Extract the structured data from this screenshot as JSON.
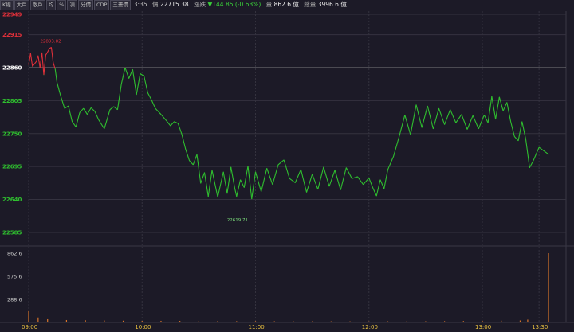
{
  "toolbar": {
    "buttons": [
      "K線",
      "大戶",
      "散戶",
      "均",
      "%",
      "凍",
      "分價",
      "CDP",
      "三畫價"
    ]
  },
  "quote": {
    "time": "13:35",
    "price_label": "價",
    "price": "22715.38",
    "change_label": "漲跌",
    "change": "▼144.85 (-0.63%)",
    "volume_label": "量",
    "volume": "862.6 億",
    "total_label": "總量",
    "total": "3996.6 億"
  },
  "colors": {
    "background": "#1c1a27",
    "up": "#e0303a",
    "down": "#2fbf2f",
    "reference_line": "#9a9a9a",
    "grid": "#34323f",
    "volume_bar": "#d8742a",
    "axis_time": "#e8c040",
    "high_annotation": "#e0303a",
    "low_annotation": "#7ce07c"
  },
  "chart_data": {
    "type": "line",
    "title": "",
    "reference_price": 22860,
    "price_range": [
      22565,
      22949
    ],
    "price_ticks": [
      "22949",
      "22915",
      "22860",
      "22805",
      "22750",
      "22695",
      "22640",
      "22585"
    ],
    "price_tick_values": [
      22949,
      22915,
      22860,
      22805,
      22750,
      22695,
      22640,
      22585
    ],
    "time_range": [
      "09:00",
      "13:35"
    ],
    "time_ticks": [
      "09:00",
      "10:00",
      "11:00",
      "12:00",
      "13:00",
      "13:30"
    ],
    "annotations": {
      "high": {
        "label": "22893.82",
        "value": 22893.82,
        "time": "09:12"
      },
      "low": {
        "label": "22619.71",
        "value": 22619.71,
        "time": "10:50"
      }
    },
    "series": [
      {
        "x": [
          "09:00",
          "09:01",
          "09:02",
          "09:04",
          "09:05",
          "09:06",
          "09:07",
          "09:08",
          "09:09",
          "09:10",
          "09:11",
          "09:12",
          "09:13",
          "09:14",
          "09:15",
          "09:17",
          "09:19",
          "09:21",
          "09:23",
          "09:25",
          "09:27",
          "09:29",
          "09:31",
          "09:33",
          "09:35",
          "09:37",
          "09:40",
          "09:43",
          "09:45",
          "09:47",
          "09:49",
          "09:51",
          "09:53",
          "09:55",
          "09:57",
          "09:59",
          "10:01",
          "10:03",
          "10:05",
          "10:07",
          "10:10",
          "10:13",
          "10:15",
          "10:17",
          "10:19",
          "10:21",
          "10:23",
          "10:25",
          "10:27",
          "10:29",
          "10:31",
          "10:33",
          "10:35",
          "10:37",
          "10:40",
          "10:43",
          "10:45",
          "10:47",
          "10:49",
          "10:50",
          "10:52",
          "10:54",
          "10:56",
          "10:58",
          "11:00",
          "11:03",
          "11:06",
          "11:09",
          "11:12",
          "11:15",
          "11:18",
          "11:21",
          "11:24",
          "11:27",
          "11:30",
          "11:33",
          "11:36",
          "11:39",
          "11:42",
          "11:45",
          "11:48",
          "11:51",
          "11:54",
          "11:57",
          "12:00",
          "12:02",
          "12:04",
          "12:06",
          "12:08",
          "12:10",
          "12:13",
          "12:16",
          "12:19",
          "12:22",
          "12:25",
          "12:28",
          "12:31",
          "12:34",
          "12:37",
          "12:40",
          "12:43",
          "12:46",
          "12:49",
          "12:52",
          "12:55",
          "12:58",
          "13:01",
          "13:03",
          "13:05",
          "13:07",
          "13:09",
          "13:11",
          "13:13",
          "13:15",
          "13:17",
          "13:19",
          "13:21",
          "13:23",
          "13:25",
          "13:27",
          "13:30",
          "13:35"
        ],
        "y": [
          22865,
          22884,
          22862,
          22870,
          22880,
          22860,
          22885,
          22848,
          22881,
          22886,
          22892,
          22893.82,
          22868,
          22858,
          22835,
          22812,
          22792,
          22796,
          22770,
          22761,
          22785,
          22792,
          22782,
          22793,
          22787,
          22773,
          22758,
          22790,
          22795,
          22790,
          22832,
          22860,
          22842,
          22857,
          22815,
          22850,
          22846,
          22818,
          22806,
          22792,
          22782,
          22771,
          22763,
          22770,
          22767,
          22749,
          22724,
          22705,
          22698,
          22715,
          22667,
          22685,
          22645,
          22689,
          22644,
          22686,
          22650,
          22694,
          22659,
          22645,
          22673,
          22660,
          22696,
          22641,
          22686,
          22653,
          22692,
          22665,
          22698,
          22706,
          22675,
          22668,
          22690,
          22652,
          22682,
          22657,
          22694,
          22662,
          22689,
          22656,
          22693,
          22675,
          22678,
          22665,
          22676,
          22660,
          22646,
          22673,
          22658,
          22690,
          22712,
          22745,
          22781,
          22748,
          22798,
          22760,
          22796,
          22758,
          22792,
          22765,
          22790,
          22768,
          22782,
          22757,
          22780,
          22758,
          22781,
          22768,
          22812,
          22774,
          22811,
          22788,
          22802,
          22770,
          22745,
          22738,
          22770,
          22740,
          22693,
          22705,
          22727,
          22715.38
        ]
      }
    ],
    "volume_range": [
      0,
      862.6
    ],
    "volume_ticks": [
      "862.6",
      "575.6",
      "288.6"
    ],
    "volume_tick_values": [
      862.6,
      575.6,
      288.6
    ],
    "volume": {
      "x": [
        "09:00",
        "09:05",
        "09:10",
        "09:20",
        "09:30",
        "09:40",
        "09:50",
        "10:00",
        "10:10",
        "10:20",
        "10:30",
        "10:40",
        "10:50",
        "11:00",
        "11:10",
        "11:20",
        "11:30",
        "11:40",
        "11:50",
        "12:00",
        "12:10",
        "12:20",
        "12:30",
        "12:40",
        "12:50",
        "13:00",
        "13:10",
        "13:20",
        "13:24",
        "13:35"
      ],
      "values": [
        150,
        62,
        40,
        30,
        28,
        25,
        22,
        20,
        20,
        20,
        18,
        18,
        16,
        16,
        15,
        15,
        14,
        14,
        14,
        13,
        14,
        14,
        15,
        16,
        18,
        20,
        22,
        25,
        35,
        862.6
      ]
    }
  }
}
